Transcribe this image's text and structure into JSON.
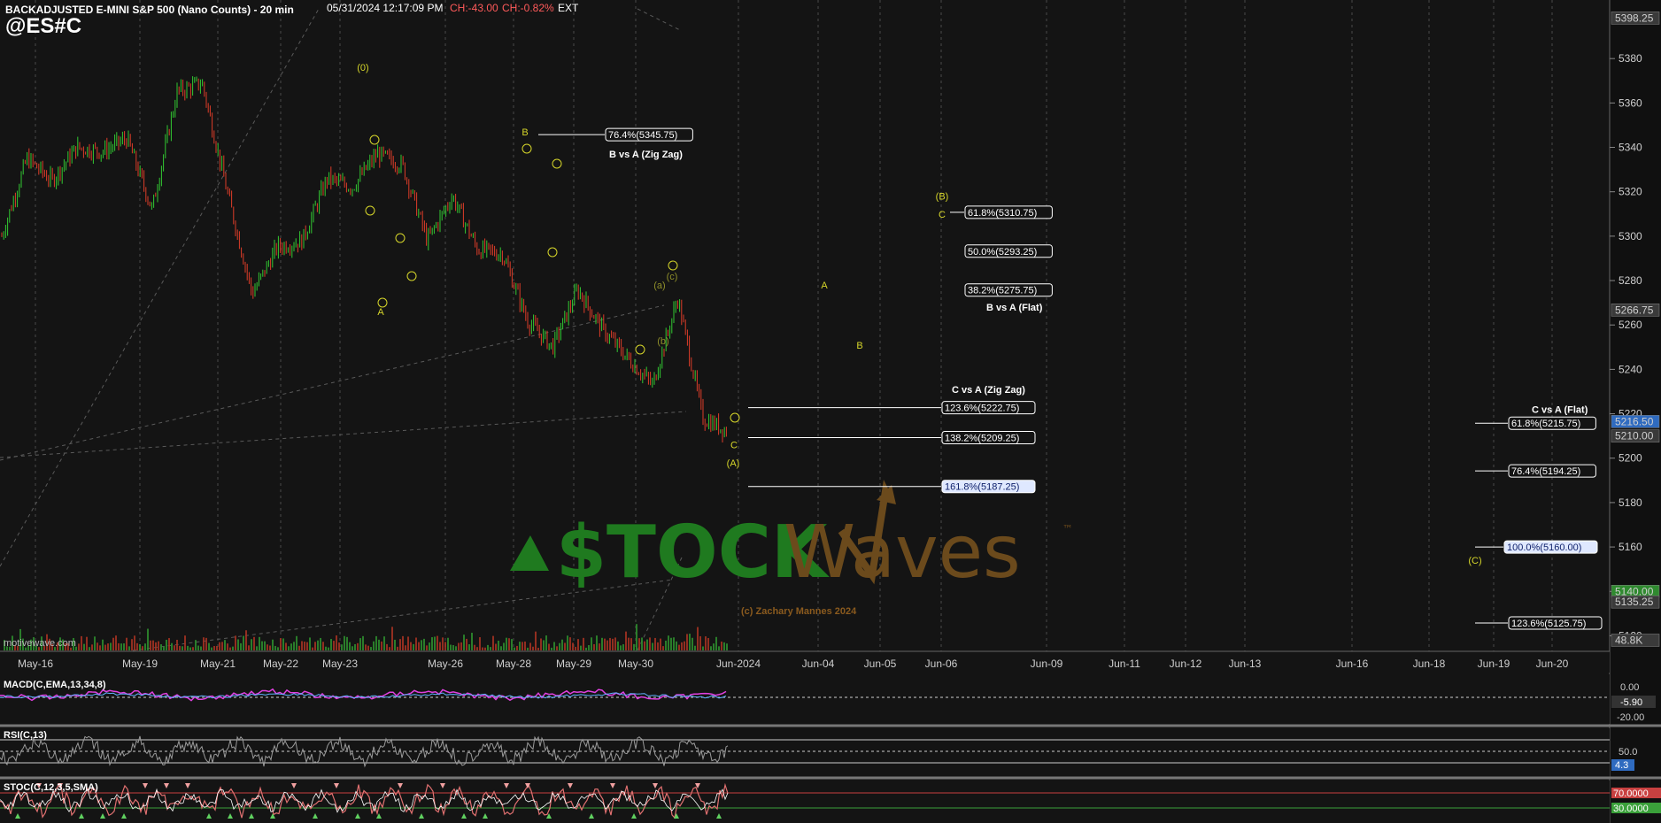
{
  "header": {
    "title": "BACKADJUSTED E-MINI S&P 500 (Nano Counts) - 20 min",
    "datetime": "05/31/2024 12:17:09 PM",
    "change": "CH:-43.00",
    "change_pct": "CH:-0.82%",
    "session": "EXT",
    "symbol": "@ES#C"
  },
  "watermark": {
    "brand_a": "$TOCK",
    "brand_b": "Waves",
    "tm": "™",
    "copyright": "(c) Zachary Mannes 2024",
    "site": "motivewave.com"
  },
  "chart_data": {
    "type": "line",
    "title": "BACKADJUSTED E-MINI S&P 500 (Nano Counts) - 20 min",
    "ylim": [
      5113,
      5400
    ],
    "y_ticks": [
      5120,
      5140,
      5160,
      5180,
      5200,
      5220,
      5240,
      5260,
      5280,
      5300,
      5320,
      5340,
      5360,
      5380
    ],
    "price_labels": [
      {
        "label": "5398.25",
        "value": 5398.25,
        "color": "#3a3a3a"
      },
      {
        "label": "5266.75",
        "value": 5266.75,
        "color": "#3a3a3a"
      },
      {
        "label": "5216.50",
        "value": 5216.5,
        "color": "#2f6bc0"
      },
      {
        "label": "5210.00",
        "value": 5210.0,
        "color": "#3a3a3a"
      },
      {
        "label": "5140.00",
        "value": 5140.0,
        "color": "#2f8a2f"
      },
      {
        "label": "5135.25",
        "value": 5135.25,
        "color": "#3a3a3a"
      },
      {
        "label": "48.8K",
        "value": 5118,
        "color": "#3a3a3a"
      }
    ],
    "x_dates": [
      "May-16",
      "May-19",
      "May-21",
      "May-22",
      "May-23",
      "May-26",
      "May-28",
      "May-29",
      "May-30",
      "Jun-2024",
      "Jun-04",
      "Jun-05",
      "Jun-06",
      "Jun-09",
      "Jun-11",
      "Jun-12",
      "Jun-13",
      "Jun-16",
      "Jun-18",
      "Jun-19",
      "Jun-20"
    ],
    "price_series": [
      {
        "date": "May-16",
        "close": 5300
      },
      {
        "date": "May-16",
        "close": 5335
      },
      {
        "date": "May-19",
        "close": 5325
      },
      {
        "date": "May-19",
        "close": 5340
      },
      {
        "date": "May-21",
        "close": 5338
      },
      {
        "date": "May-22",
        "close": 5344
      },
      {
        "date": "May-22",
        "close": 5312
      },
      {
        "date": "May-23",
        "close": 5365
      },
      {
        "date": "May-23",
        "close": 5369
      },
      {
        "date": "May-23",
        "close": 5320
      },
      {
        "date": "May-23",
        "close": 5274
      },
      {
        "date": "May-23",
        "close": 5295
      },
      {
        "date": "May-26",
        "close": 5298
      },
      {
        "date": "May-26",
        "close": 5326
      },
      {
        "date": "May-28",
        "close": 5322
      },
      {
        "date": "May-28",
        "close": 5337
      },
      {
        "date": "May-28",
        "close": 5332
      },
      {
        "date": "May-28",
        "close": 5298
      },
      {
        "date": "May-29",
        "close": 5318
      },
      {
        "date": "May-29",
        "close": 5294
      },
      {
        "date": "May-29",
        "close": 5292
      },
      {
        "date": "May-30",
        "close": 5262
      },
      {
        "date": "May-30",
        "close": 5250
      },
      {
        "date": "May-30",
        "close": 5276
      },
      {
        "date": "May-30",
        "close": 5258
      },
      {
        "date": "May-30",
        "close": 5245
      },
      {
        "date": "May-30",
        "close": 5233
      },
      {
        "date": "May-30",
        "close": 5272
      },
      {
        "date": "Jun-2024",
        "close": 5218
      },
      {
        "date": "Jun-2024",
        "close": 5212
      }
    ],
    "fib_levels": [
      {
        "label": "76.4%(5345.75)",
        "value": 5345.75,
        "highlight": false
      },
      {
        "label": "61.8%(5310.75)",
        "value": 5310.75,
        "highlight": false
      },
      {
        "label": "50.0%(5293.25)",
        "value": 5293.25,
        "highlight": false
      },
      {
        "label": "38.2%(5275.75)",
        "value": 5275.75,
        "highlight": false
      },
      {
        "label": "123.6%(5222.75)",
        "value": 5222.75,
        "highlight": false
      },
      {
        "label": "138.2%(5209.25)",
        "value": 5209.25,
        "highlight": false
      },
      {
        "label": "161.8%(5187.25)",
        "value": 5187.25,
        "highlight": true
      },
      {
        "label": "61.8%(5215.75)",
        "value": 5215.75,
        "highlight": false
      },
      {
        "label": "76.4%(5194.25)",
        "value": 5194.25,
        "highlight": false
      },
      {
        "label": "100.0%(5160.00)",
        "value": 5160.0,
        "highlight": true
      },
      {
        "label": "123.6%(5125.75)",
        "value": 5125.75,
        "highlight": false
      }
    ],
    "annotations": [
      {
        "text": "B vs A (Zig Zag)",
        "value": 5337
      },
      {
        "text": "B vs A (Flat)",
        "value": 5268
      },
      {
        "text": "C vs A (Zig Zag)",
        "value": 5231
      },
      {
        "text": "C vs A (Flat)",
        "value": 5222
      }
    ],
    "wave_labels": [
      {
        "text": "(0)",
        "value": 5376
      },
      {
        "text": "A",
        "value": 5266
      },
      {
        "text": "B",
        "value": 5347
      },
      {
        "text": "C",
        "value": 5206
      },
      {
        "text": "(A)",
        "value": 5198
      },
      {
        "text": "(B)",
        "value": 5318
      },
      {
        "text": "C",
        "value": 5310
      },
      {
        "text": "A",
        "value": 5278
      },
      {
        "text": "B",
        "value": 5251
      },
      {
        "text": "(C)",
        "value": 5154
      },
      {
        "text": "(a)",
        "value": 5278
      },
      {
        "text": "(b)",
        "value": 5253
      },
      {
        "text": "(c)",
        "value": 5282
      }
    ],
    "indicators": [
      {
        "name": "MACD(C,EMA,13,34,8)",
        "values": [
          "0.00",
          "-5.90",
          "-20.00"
        ]
      },
      {
        "name": "RSI(C,13)",
        "values": [
          "50.0",
          "4.3"
        ]
      },
      {
        "name": "STOC(C,12,3,5,SMA)",
        "values": [
          "70.0000",
          "30.0000"
        ]
      }
    ]
  },
  "colors": {
    "background": "#141414",
    "up": "#32c832",
    "down": "#dc3c28",
    "wave_label": "#d6d62a",
    "fib_line": "#ffffff",
    "brand_green": "#1f7a1f",
    "brand_brown": "#6b4a1c"
  }
}
